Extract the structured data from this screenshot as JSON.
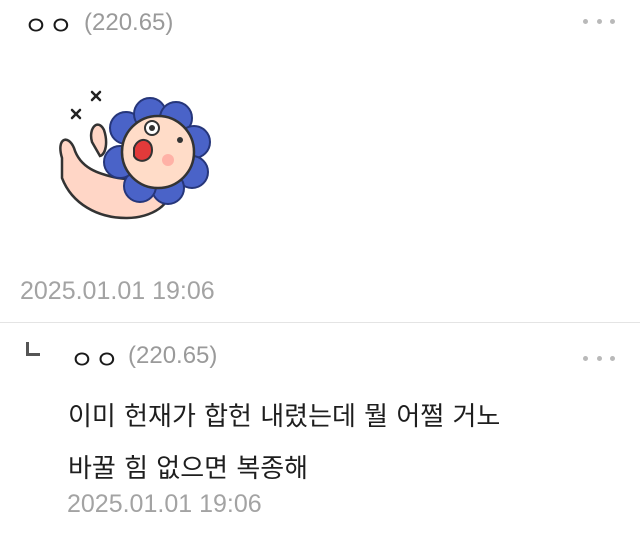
{
  "comments": [
    {
      "author": "ㅇㅇ",
      "ip": "(220.65)",
      "sticker_icon": "fainted-lion-sticker",
      "timestamp": "2025.01.01 19:06"
    },
    {
      "author": "ㅇㅇ",
      "ip": "(220.65)",
      "lines": [
        "이미 헌재가 합헌 내렸는데 뭘 어쩔 거노",
        "바꿀 힘 없으면 복종해"
      ],
      "timestamp": "2025.01.01 19:06"
    }
  ],
  "colors": {
    "meta_text": "#a3a3a3",
    "divider": "#e4e4e4",
    "lion_mane": "#4a63c8",
    "lion_face": "#ffdcc8",
    "mouth": "#e23a3a"
  }
}
